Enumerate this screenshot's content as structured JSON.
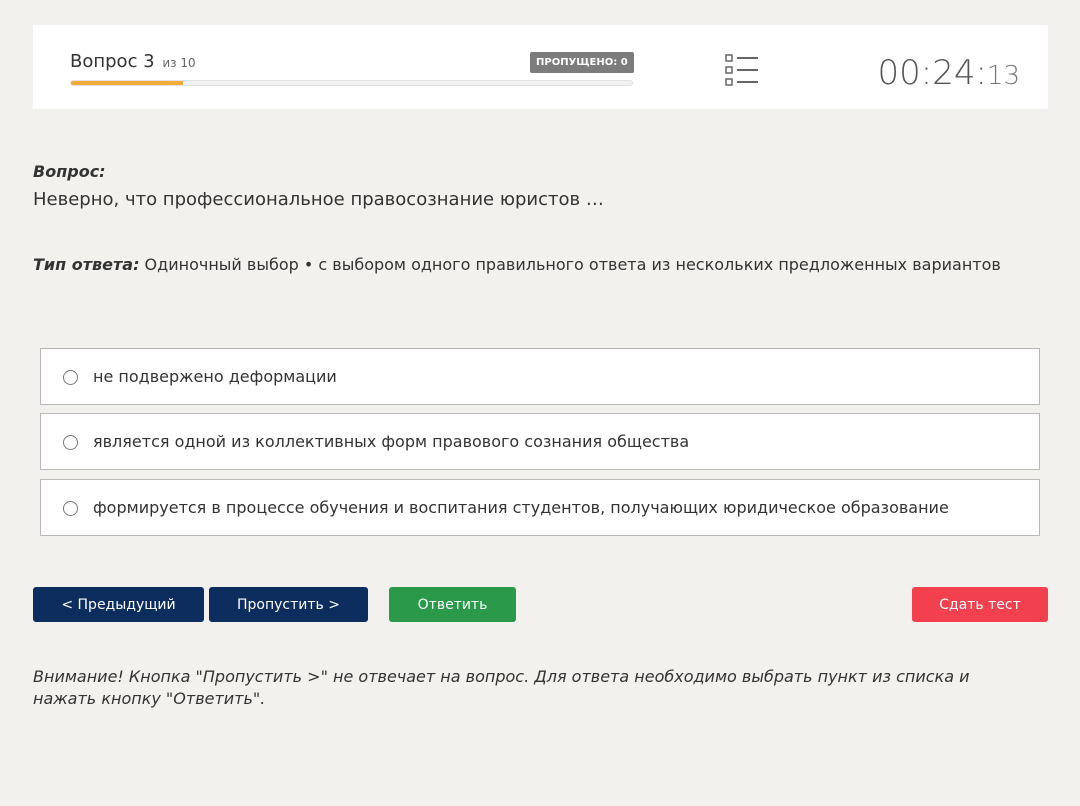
{
  "header": {
    "question_label": "Вопрос 3",
    "question_of": "из 10",
    "skipped_badge": "ПРОПУЩЕНО: 0",
    "progress_fraction": 0.2,
    "timer_main": "00:24:",
    "timer_seconds": "13",
    "list_icon": "list-icon"
  },
  "question": {
    "label": "Вопрос:",
    "text": "Неверно, что профессиональное правосознание юристов …"
  },
  "answer_type": {
    "label": "Тип ответа:",
    "value": " Одиночный выбор • с выбором одного правильного ответа из нескольких предложенных вариантов"
  },
  "options": [
    {
      "text": "не подвержено деформации"
    },
    {
      "text": "является одной из коллективных форм правового сознания общества"
    },
    {
      "text": "формируется в процессе обучения и воспитания студентов, получающих юридическое образование"
    }
  ],
  "buttons": {
    "prev": "< Предыдущий",
    "skip": "Пропустить >",
    "answer": "Ответить",
    "submit": "Сдать тест"
  },
  "colors": {
    "progress": "#f0ad3c",
    "nav_button": "#0c2d5e",
    "answer_button": "#2a9a4a",
    "submit_button": "#f2404f"
  },
  "warning": "Внимание! Кнопка \"Пропустить >\" не отвечает на вопрос. Для ответа необходимо выбрать пункт из списка и нажать кнопку \"Ответить\"."
}
